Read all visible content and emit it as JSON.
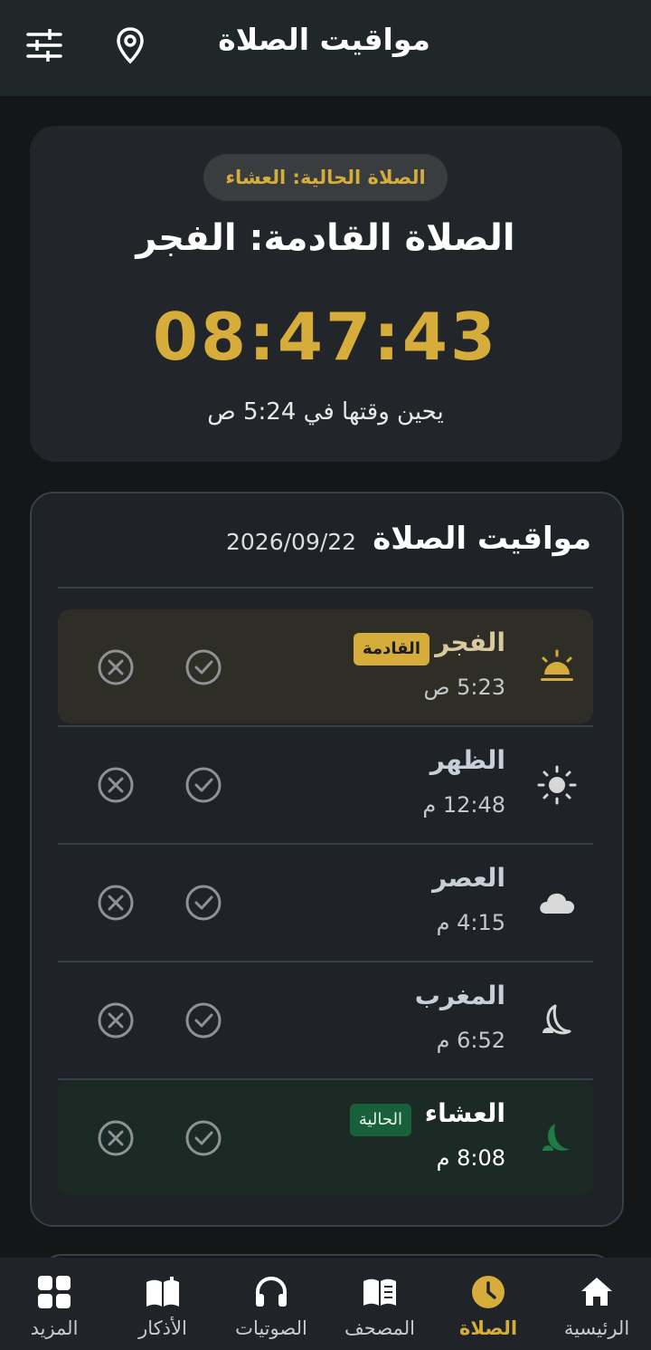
{
  "appbar": {
    "title": "مواقيت الصلاة",
    "settings_icon": "sliders-icon",
    "location_icon": "location-pin-icon"
  },
  "next_card": {
    "current_label": "الصلاة الحالية: العشاء",
    "next_title": "الصلاة القادمة: الفجر",
    "countdown": "08:47:43",
    "due_text": "يحين وقتها في 5:24 ص"
  },
  "times_card": {
    "title": "مواقيت الصلاة",
    "date": "2026/09/22",
    "prayers": [
      {
        "name": "الفجر",
        "time": "5:23 ص",
        "badge": "القادمة",
        "icon": "sunrise-icon"
      },
      {
        "name": "الظهر",
        "time": "12:48 م",
        "icon": "sun-icon"
      },
      {
        "name": "العصر",
        "time": "4:15 م",
        "icon": "cloud-icon"
      },
      {
        "name": "المغرب",
        "time": "6:52 م",
        "icon": "sunset-moon-icon"
      },
      {
        "name": "العشاء",
        "time": "8:08 م",
        "badge": "الحالية",
        "icon": "moon-icon"
      }
    ]
  },
  "nav": {
    "home": "الرئيسية",
    "prayer": "الصلاة",
    "mushaf": "المصحف",
    "audio": "الصوتيات",
    "azkar": "الأذكار",
    "more": "المزيد"
  },
  "colors": {
    "accent": "#d6ad3a",
    "current_green": "#17603a",
    "background": "#141618"
  }
}
